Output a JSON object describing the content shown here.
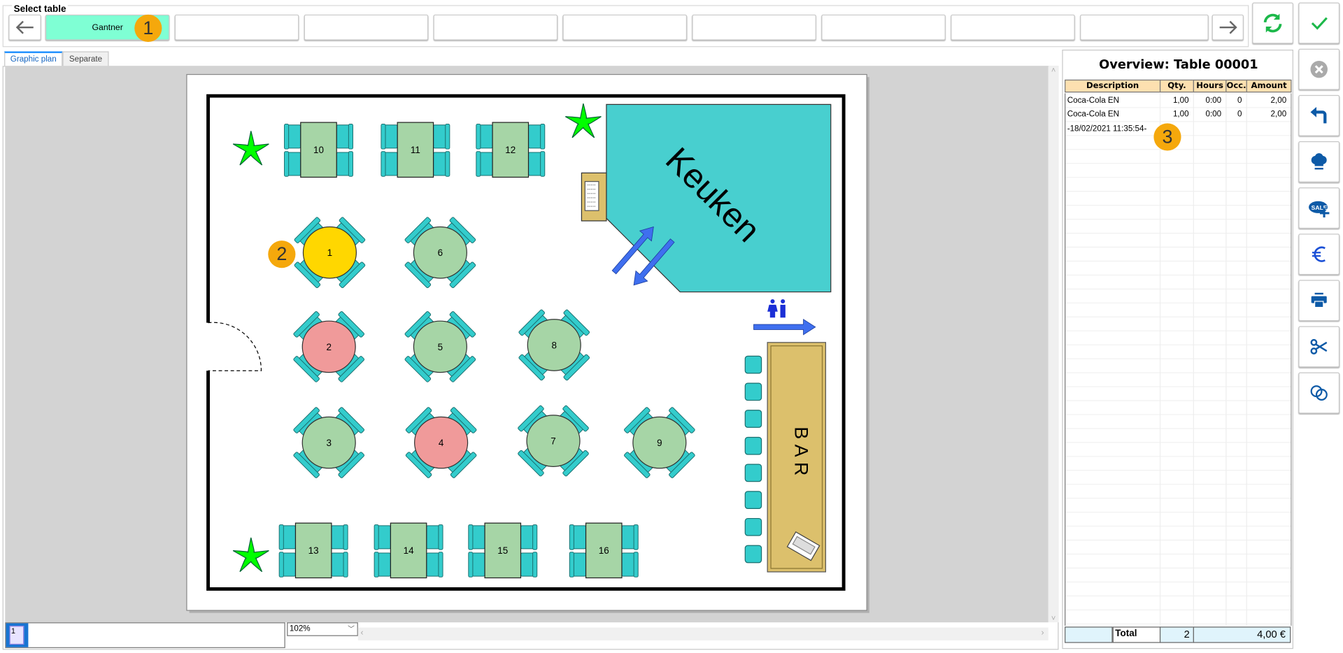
{
  "select_table": {
    "label": "Select table",
    "buttons": [
      "Gantner",
      "",
      "",
      "",
      "",
      "",
      "",
      "",
      ""
    ],
    "selected": 0
  },
  "tabs": [
    {
      "label": "Graphic plan",
      "active": true
    },
    {
      "label": "Separate",
      "active": false
    }
  ],
  "plan": {
    "tables": [
      {
        "number": "10",
        "shape": "rect",
        "status": "free"
      },
      {
        "number": "11",
        "shape": "rect",
        "status": "free"
      },
      {
        "number": "12",
        "shape": "rect",
        "status": "free"
      },
      {
        "number": "1",
        "shape": "round",
        "status": "selected"
      },
      {
        "number": "6",
        "shape": "round",
        "status": "free"
      },
      {
        "number": "2",
        "shape": "round",
        "status": "occupied"
      },
      {
        "number": "5",
        "shape": "round",
        "status": "free"
      },
      {
        "number": "8",
        "shape": "round",
        "status": "free"
      },
      {
        "number": "3",
        "shape": "round",
        "status": "free"
      },
      {
        "number": "4",
        "shape": "round",
        "status": "occupied"
      },
      {
        "number": "7",
        "shape": "round",
        "status": "free"
      },
      {
        "number": "9",
        "shape": "round",
        "status": "free"
      },
      {
        "number": "13",
        "shape": "rect",
        "status": "free"
      },
      {
        "number": "14",
        "shape": "rect",
        "status": "free"
      },
      {
        "number": "15",
        "shape": "rect",
        "status": "free"
      },
      {
        "number": "16",
        "shape": "rect",
        "status": "free"
      }
    ],
    "kitchen_label": "Keuken",
    "bar_label": "BAR",
    "colors": {
      "free": "#a6d5a6",
      "selected": "#ffd700",
      "occupied": "#f09a9a",
      "chair": "#33cccc",
      "kitchen": "#48cfcf",
      "bar": "#dcc06c",
      "plant": "#00ff00",
      "arrow": "#3f6fef"
    }
  },
  "bottom": {
    "page": "1",
    "zoom": "102%"
  },
  "overview": {
    "title": "Overview: Table 00001",
    "columns": [
      "Description",
      "Qty.",
      "Hours",
      "Occ.",
      "Amount"
    ],
    "rows": [
      {
        "description": "Coca-Cola EN",
        "qty": "1,00",
        "hours": "0:00",
        "occ": "0",
        "amount": "2,00"
      },
      {
        "description": "Coca-Cola EN",
        "qty": "1,00",
        "hours": "0:00",
        "occ": "0",
        "amount": "2,00"
      },
      {
        "description": "-18/02/2021 11:35:54-",
        "qty": "",
        "hours": "",
        "occ": "",
        "amount": ""
      }
    ],
    "total": {
      "label": "Total",
      "qty": "2",
      "amount": "4,00 €"
    }
  },
  "side_buttons": [
    "confirm-check",
    "cancel",
    "undo",
    "chef-hat",
    "sale-plus",
    "euro",
    "print",
    "scissors",
    "split-circles"
  ],
  "badges": [
    "1",
    "2",
    "3"
  ]
}
